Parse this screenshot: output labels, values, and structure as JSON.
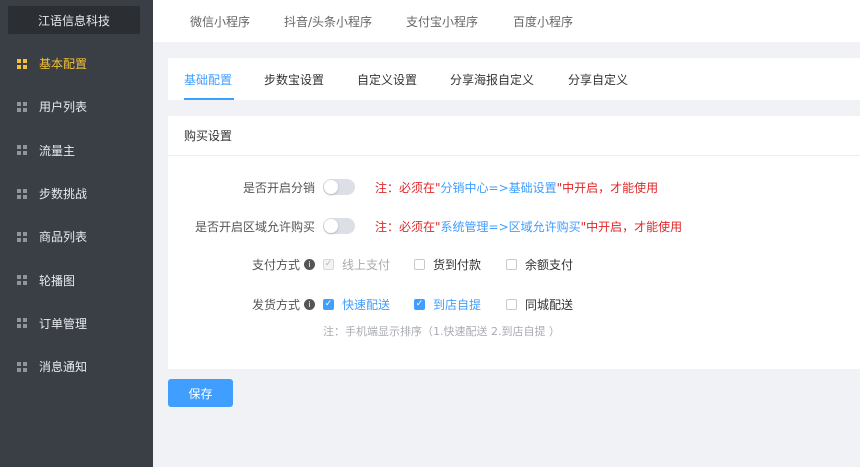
{
  "brand": "江语信息科技",
  "sidebar": {
    "items": [
      {
        "label": "基本配置",
        "active": true
      },
      {
        "label": "用户列表"
      },
      {
        "label": "流量主"
      },
      {
        "label": "步数挑战"
      },
      {
        "label": "商品列表"
      },
      {
        "label": "轮播图"
      },
      {
        "label": "订单管理"
      },
      {
        "label": "消息通知"
      }
    ]
  },
  "top_tabs": [
    "微信小程序",
    "抖音/头条小程序",
    "支付宝小程序",
    "百度小程序"
  ],
  "sub_tabs": [
    "基础配置",
    "步数宝设置",
    "自定义设置",
    "分享海报自定义",
    "分享自定义"
  ],
  "card": {
    "title": "购买设置",
    "distribution": {
      "label": "是否开启分销",
      "note_prefix": "注：必须在\"",
      "note_link": "分销中心=>基础设置",
      "note_suffix": "\"中开启，才能使用"
    },
    "region": {
      "label": "是否开启区域允许购买",
      "note_prefix": "注：必须在\"",
      "note_link": "系统管理=>区域允许购买",
      "note_suffix": "\"中开启，才能使用"
    },
    "payment": {
      "label": "支付方式",
      "options": [
        "线上支付",
        "货到付款",
        "余额支付"
      ]
    },
    "delivery": {
      "label": "发货方式",
      "options": [
        "快速配送",
        "到店自提",
        "同城配送"
      ],
      "hint": "注：手机端显示排序（1.快速配送 2.到店自提 ）"
    }
  },
  "save_label": "保存",
  "colors": {
    "accent": "#409eff",
    "warning": "#e02828",
    "sidebar": "#3a3f46",
    "active_menu": "#f2c037"
  }
}
